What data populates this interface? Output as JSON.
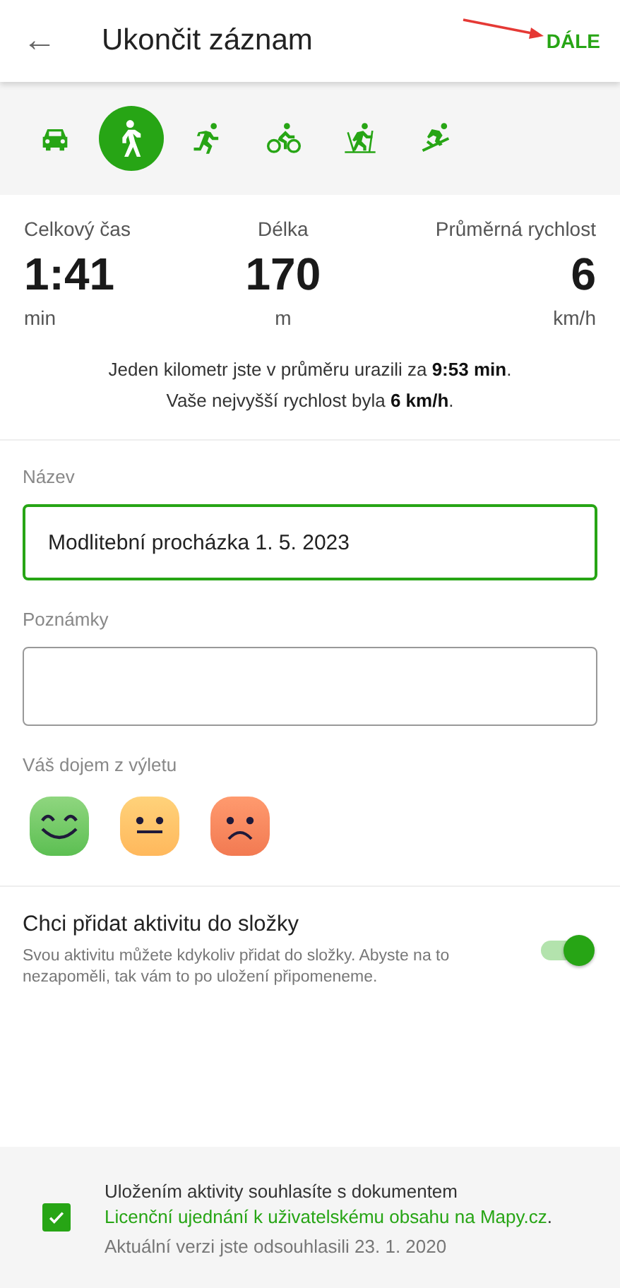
{
  "header": {
    "back": "←",
    "title": "Ukončit záznam",
    "action": "DÁLE"
  },
  "modes": [
    {
      "kind": "car",
      "selected": false
    },
    {
      "kind": "walk",
      "selected": true
    },
    {
      "kind": "run",
      "selected": false
    },
    {
      "kind": "bike",
      "selected": false
    },
    {
      "kind": "crosscountry",
      "selected": false
    },
    {
      "kind": "downhill",
      "selected": false
    }
  ],
  "stats": [
    {
      "label": "Celkový čas",
      "value": "1:41",
      "unit": "min"
    },
    {
      "label": "Délka",
      "value": "170",
      "unit": "m"
    },
    {
      "label": "Průměrná rychlost",
      "value": "6",
      "unit": "km/h"
    }
  ],
  "summary": [
    "Jeden kilometr jste v průměru urazili za **9:53 min**.",
    "Vaše nejvyšší rychlost byla **6 km/h**."
  ],
  "name_field": {
    "label": "Název",
    "value": "Modlitební procházka 1. 5. 2023"
  },
  "notes_field": {
    "label": "Poznámky"
  },
  "mood": {
    "label": "Váš dojem z výletu",
    "options": [
      {
        "kind": "happy"
      },
      {
        "kind": "neutral"
      },
      {
        "kind": "sad"
      }
    ]
  },
  "folder": {
    "title": "Chci přidat aktivitu do složky",
    "description": "Svou aktivitu můžete kdykoliv přidat do složky. Abyste na to nezapoměli, tak vám to po uložení připomeneme.",
    "on": true
  },
  "consent": {
    "checked": true,
    "text": "Uložením aktivity souhlasíte s dokumentem",
    "link": "Licenční ujednání k uživatelskému obsahu na Mapy.cz",
    "after": ".",
    "note": "Aktuální verzi jste odsouhlasili 23. 1. 2020"
  }
}
